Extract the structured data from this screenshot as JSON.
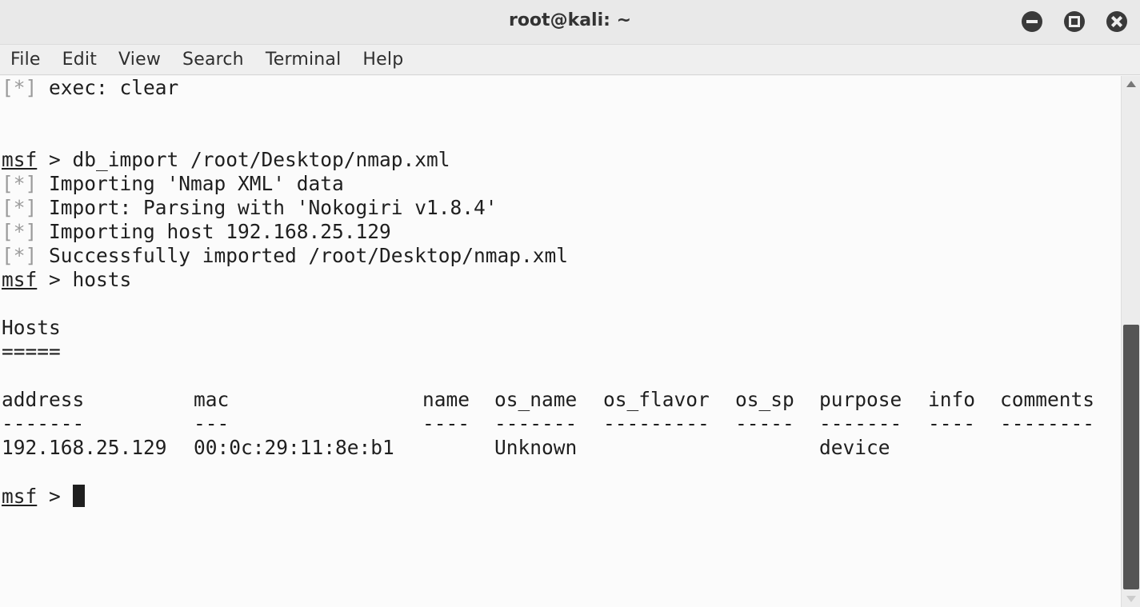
{
  "window": {
    "title": "root@kali: ~"
  },
  "menu": {
    "items": [
      "File",
      "Edit",
      "View",
      "Search",
      "Terminal",
      "Help"
    ]
  },
  "terminal": {
    "lines": {
      "exec": {
        "tag": "[*]",
        "text": " exec: clear"
      },
      "cmd_import": {
        "prompt": "msf",
        "text": " > db_import /root/Desktop/nmap.xml"
      },
      "import1": {
        "tag": "[*]",
        "text": " Importing 'Nmap XML' data"
      },
      "import2": {
        "tag": "[*]",
        "text": " Import: Parsing with 'Nokogiri v1.8.4'"
      },
      "import3": {
        "tag": "[*]",
        "text": " Importing host 192.168.25.129"
      },
      "import4": {
        "tag": "[*]",
        "text": " Successfully imported /root/Desktop/nmap.xml"
      },
      "cmd_hosts": {
        "prompt": "msf",
        "text": " > hosts"
      },
      "hosts_title": "Hosts",
      "hosts_underline": "=====",
      "final_prompt": {
        "prompt": "msf",
        "text": " > "
      }
    },
    "hosts_table": {
      "headers": [
        "address",
        "mac",
        "name",
        "os_name",
        "os_flavor",
        "os_sp",
        "purpose",
        "info",
        "comments"
      ],
      "separators": [
        "-------",
        "---",
        "----",
        "-------",
        "---------",
        "-----",
        "-------",
        "----",
        "--------"
      ],
      "rows": [
        [
          "192.168.25.129",
          "00:0c:29:11:8e:b1",
          "",
          "Unknown",
          "",
          "",
          "device",
          "",
          ""
        ]
      ]
    }
  }
}
